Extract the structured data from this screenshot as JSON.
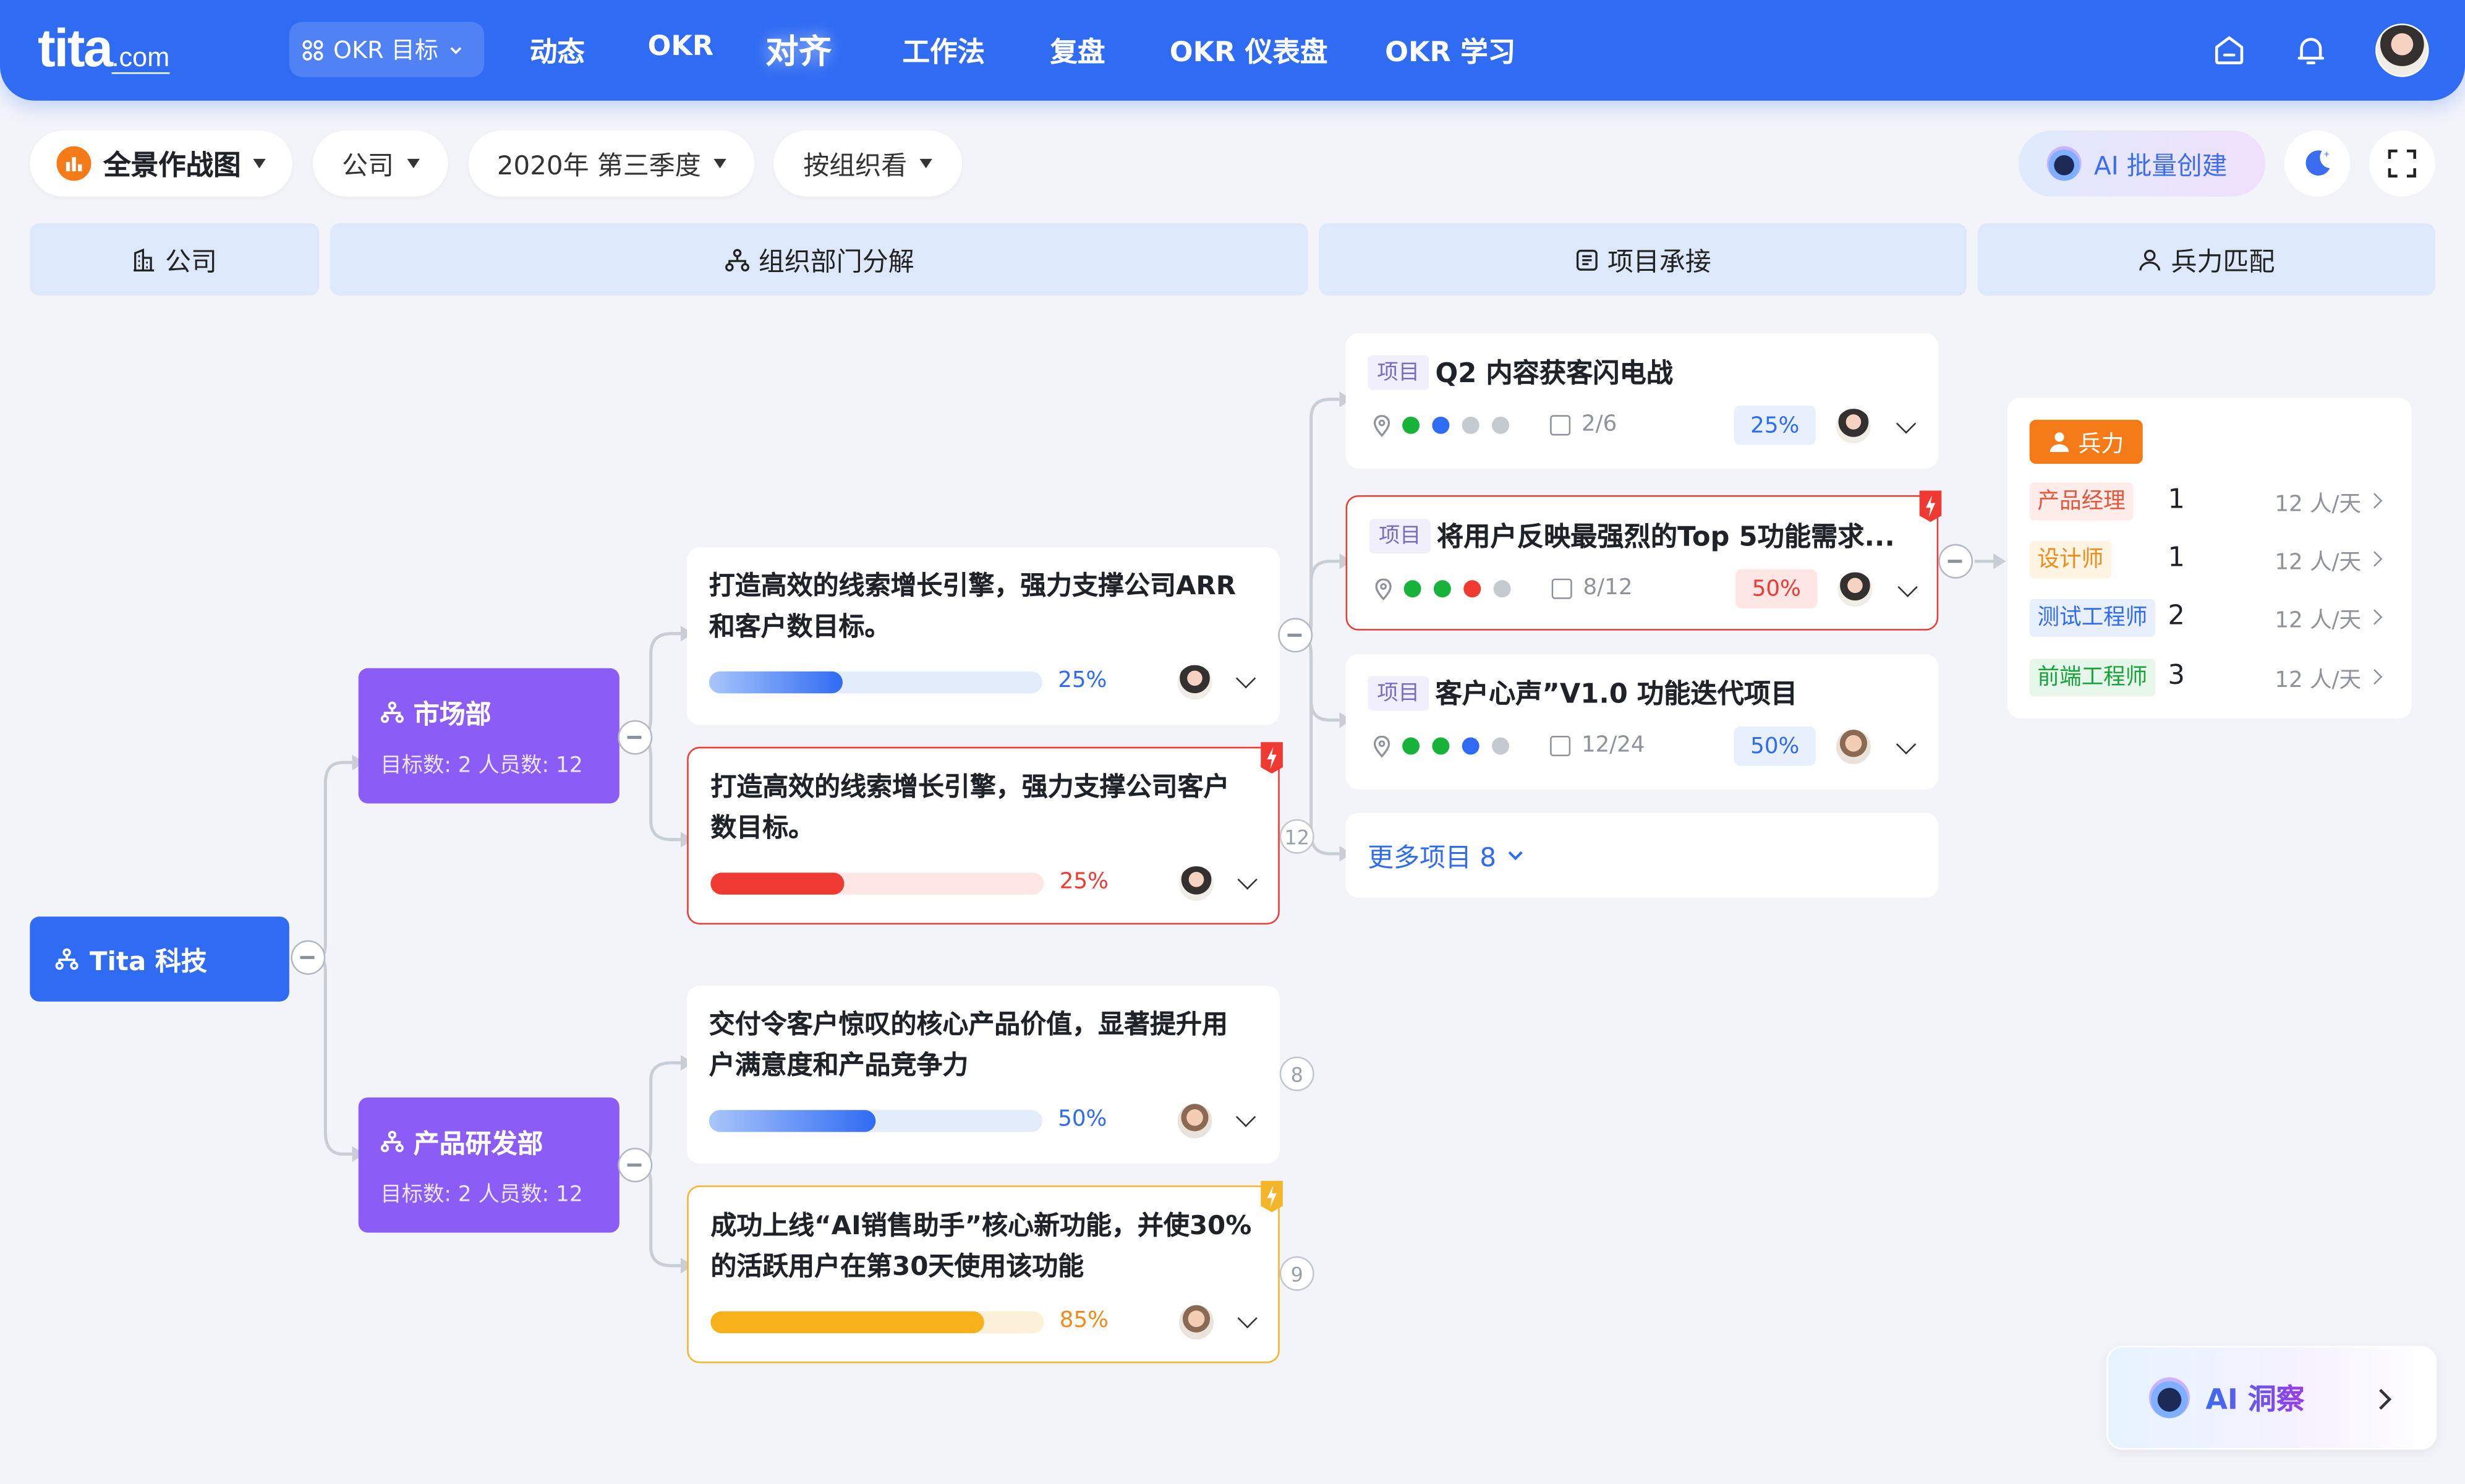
{
  "brand": {
    "name": "tita",
    "suffix": ".com"
  },
  "nav": {
    "okr_target": "OKR 目标",
    "items": [
      "动态",
      "OKR",
      "对齐",
      "工作法",
      "复盘",
      "OKR 仪表盘",
      "OKR 学习"
    ],
    "active": "对齐"
  },
  "toolbar": {
    "view": "全景作战图",
    "scope": "公司",
    "period": "2020年 第三季度",
    "group": "按组织看",
    "ai_batch": "AI 批量创建"
  },
  "columns": [
    "公司",
    "组织部门分解",
    "项目承接",
    "兵力匹配"
  ],
  "company": {
    "name": "Tita 科技"
  },
  "departments": [
    {
      "name": "市场部",
      "stats": "目标数: 2    人员数: 12"
    },
    {
      "name": "产品研发部",
      "stats": "目标数: 2    人员数: 12"
    }
  ],
  "objectives": [
    {
      "title": "打造高效的线索增长引擎，强力支撑公司ARR和客户数目标。",
      "progress": 25,
      "progress_label": "25%",
      "status": "normal",
      "count": ""
    },
    {
      "title": "打造高效的线索增长引擎，强力支撑公司客户数目标。",
      "progress": 25,
      "progress_label": "25%",
      "status": "risk",
      "count": "12"
    },
    {
      "title": "交付令客户惊叹的核心产品价值，显著提升用户满意度和产品竞争力",
      "progress": 50,
      "progress_label": "50%",
      "status": "normal",
      "count": "8"
    },
    {
      "title": "成功上线“AI销售助手”核心新功能，并使30%的活跃用户在第30天使用该功能",
      "progress": 85,
      "progress_label": "85%",
      "status": "warning",
      "count": "9"
    }
  ],
  "projects": [
    {
      "tag": "项目",
      "title": "Q2 内容获客闪电战",
      "tasks": "2/6",
      "progress_label": "25%",
      "dots": [
        "#18b33a",
        "#2f6bf3",
        "#c5c9d0",
        "#c5c9d0"
      ],
      "status": "normal"
    },
    {
      "tag": "项目",
      "title": "将用户反映最强烈的Top 5功能需求...",
      "tasks": "8/12",
      "progress_label": "50%",
      "dots": [
        "#18b33a",
        "#18b33a",
        "#ee3a31",
        "#c5c9d0"
      ],
      "status": "risk"
    },
    {
      "tag": "项目",
      "title": "客户心声”V1.0 功能迭代项目",
      "tasks": "12/24",
      "progress_label": "50%",
      "dots": [
        "#18b33a",
        "#18b33a",
        "#2f6bf3",
        "#c5c9d0"
      ],
      "status": "normal"
    }
  ],
  "more_projects": {
    "label": "更多项目 8"
  },
  "force": {
    "title": "兵力",
    "roles": [
      {
        "name": "产品经理",
        "count": "1",
        "rate": "12 人/天",
        "color": "#e8553a",
        "bg": "#fdecea"
      },
      {
        "name": "设计师",
        "count": "1",
        "rate": "12 人/天",
        "color": "#f08a1a",
        "bg": "#fff3e2"
      },
      {
        "name": "测试工程师",
        "count": "2",
        "rate": "12 人/天",
        "color": "#2f6bf3",
        "bg": "#e8f0fe"
      },
      {
        "name": "前端工程师",
        "count": "3",
        "rate": "12 人/天",
        "color": "#18a33a",
        "bg": "#e6f6ea"
      }
    ]
  },
  "ai_insight": {
    "label": "AI 洞察"
  }
}
